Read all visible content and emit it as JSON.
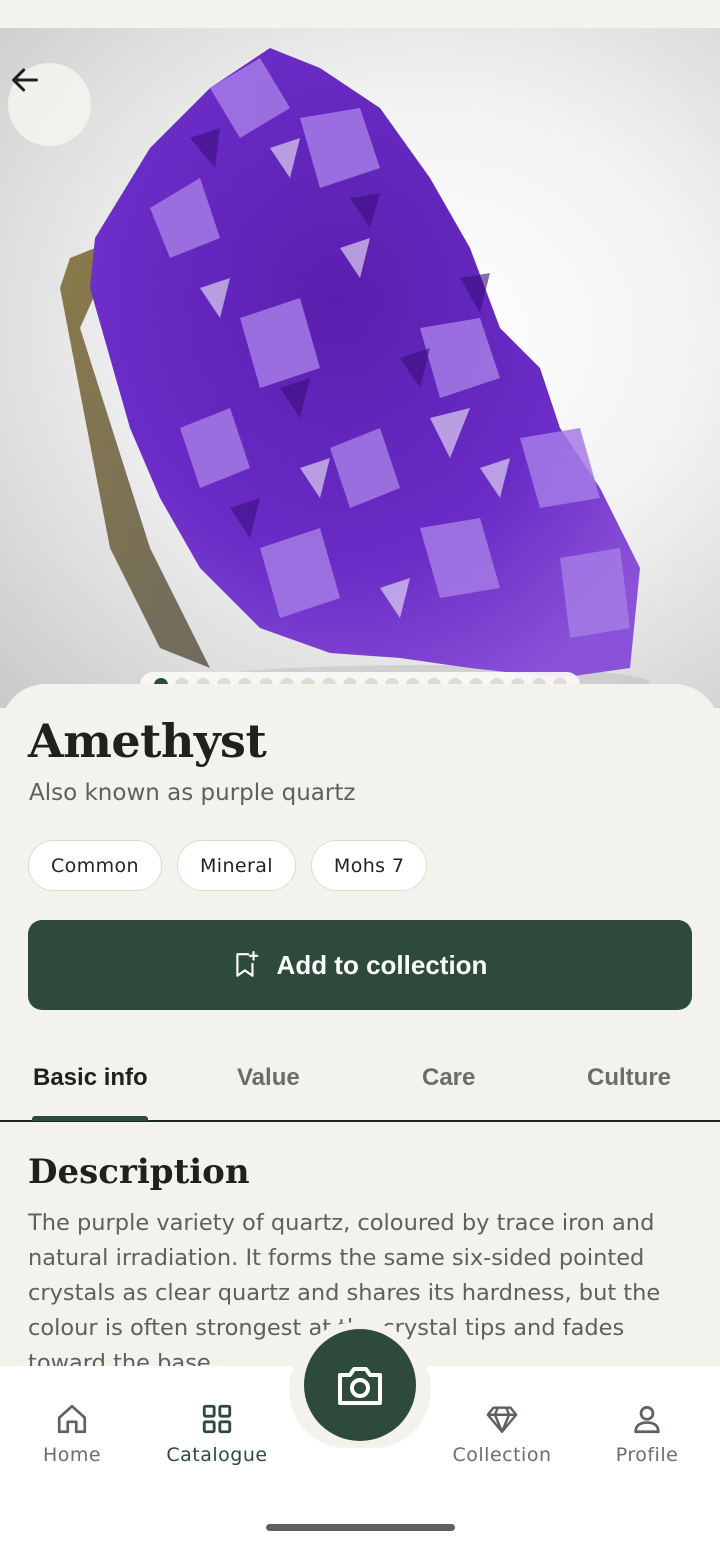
{
  "image_dots": {
    "total": 20,
    "active_index": 0
  },
  "mineral": {
    "name": "Amethyst",
    "aka": "Also known as purple quartz",
    "tags": [
      "Common",
      "Mineral",
      "Mohs 7"
    ]
  },
  "actions": {
    "add_label": "Add to collection"
  },
  "tabs": [
    {
      "label": "Basic info",
      "active": true
    },
    {
      "label": "Value",
      "active": false
    },
    {
      "label": "Care",
      "active": false
    },
    {
      "label": "Culture",
      "active": false
    }
  ],
  "description": {
    "heading": "Description",
    "text": "The purple variety of quartz, coloured by trace iron and natural irradiation. It forms the same six-sided pointed crystals as clear quartz and shares its hardness, but the colour is often strongest at the crystal tips and fades toward the base."
  },
  "nav": [
    {
      "label": "Home",
      "icon": "home-icon",
      "active": false
    },
    {
      "label": "Catalogue",
      "icon": "grid-icon",
      "active": true
    },
    {
      "label": "Collection",
      "icon": "gem-icon",
      "active": false
    },
    {
      "label": "Profile",
      "icon": "person-icon",
      "active": false
    }
  ],
  "fab_icon": "camera-icon",
  "colors": {
    "primary": "#2d4a3b",
    "background": "#f4f2ec",
    "crystal": "#7a3fd0"
  }
}
